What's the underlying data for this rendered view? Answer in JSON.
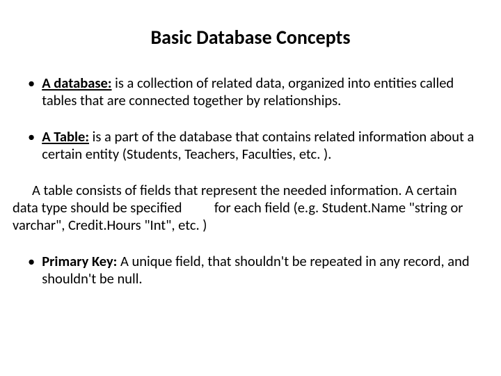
{
  "title": "Basic Database Concepts",
  "items": {
    "db_term": "A database:",
    "db_def": " is a collection of related data, organized into entities called tables that are connected together by relationships.",
    "table_term": "A Table:",
    "table_def": " is a part of the database that contains related information about a certain entity (Students, Teachers, Faculties, etc. ).",
    "table_para": "A table consists of fields that represent the needed information. A certain data type should be specified          for each field (e.g. Student.Name \"string or varchar\", Credit.Hours \"Int\", etc. )",
    "pk_term": "Primary Key:",
    "pk_def": " A unique field, that shouldn't be repeated in any record, and shouldn't be null."
  }
}
